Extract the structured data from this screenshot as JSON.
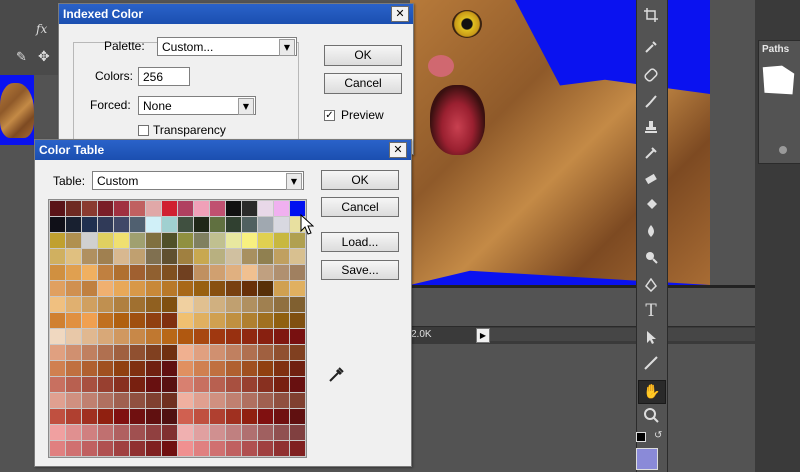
{
  "background": {
    "doc_status": "2.0K",
    "paths_panel_title": "Paths"
  },
  "indexed_color": {
    "title": "Indexed Color",
    "palette_label": "Palette:",
    "palette_value": "Custom...",
    "colors_label": "Colors:",
    "colors_value": "256",
    "forced_label": "Forced:",
    "forced_value": "None",
    "transparency_label": "Transparency",
    "transparency_checked": false,
    "ok_label": "OK",
    "cancel_label": "Cancel",
    "preview_label": "Preview",
    "preview_checked": true
  },
  "color_table": {
    "title": "Color Table",
    "table_label": "Table:",
    "table_value": "Custom",
    "ok_label": "OK",
    "cancel_label": "Cancel",
    "load_label": "Load...",
    "save_label": "Save...",
    "swatches": [
      [
        "#5a1418",
        "#6e2a22",
        "#8a3a30",
        "#7a1e28",
        "#a03040",
        "#c06060",
        "#e0a8a8",
        "#d02030",
        "#b04060",
        "#f0a0b8",
        "#c05070",
        "#101010",
        "#2a2a2a",
        "#e8d8e8",
        "#f0b0f0",
        "#0010f0"
      ],
      [
        "#101018",
        "#182030",
        "#203050",
        "#303a58",
        "#404868",
        "#506070",
        "#d0f0f8",
        "#a0d0d0",
        "#405040",
        "#202818",
        "#607040",
        "#304030",
        "#506060",
        "#a0a8b0",
        "#d8d8e0",
        "#e8e0a0"
      ],
      [
        "#c0a030",
        "#b09050",
        "#d0d0d0",
        "#e0d060",
        "#f0e070",
        "#a0a070",
        "#807040",
        "#505028",
        "#909040",
        "#808060",
        "#c0c090",
        "#e8e8a0",
        "#f8f080",
        "#e0d050",
        "#c8b840",
        "#b0a050"
      ],
      [
        "#d0b060",
        "#e0c080",
        "#b09060",
        "#a08050",
        "#d8b890",
        "#c0a070",
        "#807050",
        "#605030",
        "#a08040",
        "#c8a850",
        "#b8b080",
        "#d0c0a0",
        "#a89060",
        "#908050",
        "#c0a060",
        "#d8c090"
      ],
      [
        "#d09040",
        "#e0a050",
        "#f0b060",
        "#c08040",
        "#b07030",
        "#a06030",
        "#906030",
        "#805020",
        "#704020",
        "#c09060",
        "#d0a070",
        "#e0b080",
        "#f0c090",
        "#c0a080",
        "#b09070",
        "#a08060"
      ],
      [
        "#e0a060",
        "#d09050",
        "#c08040",
        "#f0b070",
        "#e8a858",
        "#d89848",
        "#c88838",
        "#b87828",
        "#a86818",
        "#986010",
        "#885010",
        "#784010",
        "#683008",
        "#583008",
        "#d0a050",
        "#e0b060"
      ],
      [
        "#f0c080",
        "#e0b070",
        "#d0a060",
        "#c09050",
        "#b08040",
        "#a07030",
        "#906020",
        "#805010",
        "#f0d0a0",
        "#e0c090",
        "#d0b080",
        "#c0a070",
        "#b09060",
        "#a08050",
        "#907040",
        "#806030"
      ],
      [
        "#d08030",
        "#e09040",
        "#f0a050",
        "#c07020",
        "#b06010",
        "#a05010",
        "#904010",
        "#803010",
        "#f0c070",
        "#e0b060",
        "#d0a050",
        "#c09040",
        "#b08030",
        "#a07020",
        "#906010",
        "#805010"
      ],
      [
        "#f0d8c0",
        "#e8c8a8",
        "#e0b890",
        "#d8a878",
        "#d09860",
        "#c88848",
        "#c07830",
        "#b86818",
        "#b05810",
        "#a84810",
        "#a03810",
        "#983010",
        "#902810",
        "#882010",
        "#801810",
        "#781010"
      ],
      [
        "#e0a080",
        "#d09070",
        "#c08060",
        "#b07050",
        "#a06040",
        "#905030",
        "#804020",
        "#703010",
        "#f0b090",
        "#e0a080",
        "#d09070",
        "#c08060",
        "#b07050",
        "#a06040",
        "#905030",
        "#804020"
      ],
      [
        "#d08050",
        "#c07040",
        "#b06030",
        "#a05020",
        "#904010",
        "#803010",
        "#702010",
        "#601010",
        "#e09060",
        "#d08050",
        "#c07040",
        "#b06030",
        "#a05020",
        "#904010",
        "#803010",
        "#702010"
      ],
      [
        "#c87060",
        "#b86050",
        "#a85040",
        "#984030",
        "#883020",
        "#782010",
        "#681010",
        "#581010",
        "#d88070",
        "#c87060",
        "#b86050",
        "#a85040",
        "#984030",
        "#883020",
        "#782010",
        "#681010"
      ],
      [
        "#e0a090",
        "#d09080",
        "#c08070",
        "#b07060",
        "#a06050",
        "#905040",
        "#804030",
        "#703020",
        "#f0b0a0",
        "#e0a090",
        "#d09080",
        "#c08070",
        "#b07060",
        "#a06050",
        "#905040",
        "#804030"
      ],
      [
        "#c05040",
        "#b04030",
        "#a03020",
        "#902010",
        "#801010",
        "#701010",
        "#601010",
        "#501010",
        "#d06050",
        "#c05040",
        "#b04030",
        "#a03020",
        "#902010",
        "#801010",
        "#701010",
        "#601010"
      ],
      [
        "#f0a0a0",
        "#e09090",
        "#d08080",
        "#c07070",
        "#b06060",
        "#a05050",
        "#904040",
        "#803030",
        "#f0b0b0",
        "#e0a0a0",
        "#d09090",
        "#c08080",
        "#b07070",
        "#a06060",
        "#905050",
        "#804040"
      ],
      [
        "#e08080",
        "#d07070",
        "#c06060",
        "#b05050",
        "#a04040",
        "#903030",
        "#802020",
        "#701010",
        "#f09090",
        "#e08080",
        "#d07070",
        "#c06060",
        "#b05050",
        "#a04040",
        "#903030",
        "#802020"
      ]
    ]
  }
}
